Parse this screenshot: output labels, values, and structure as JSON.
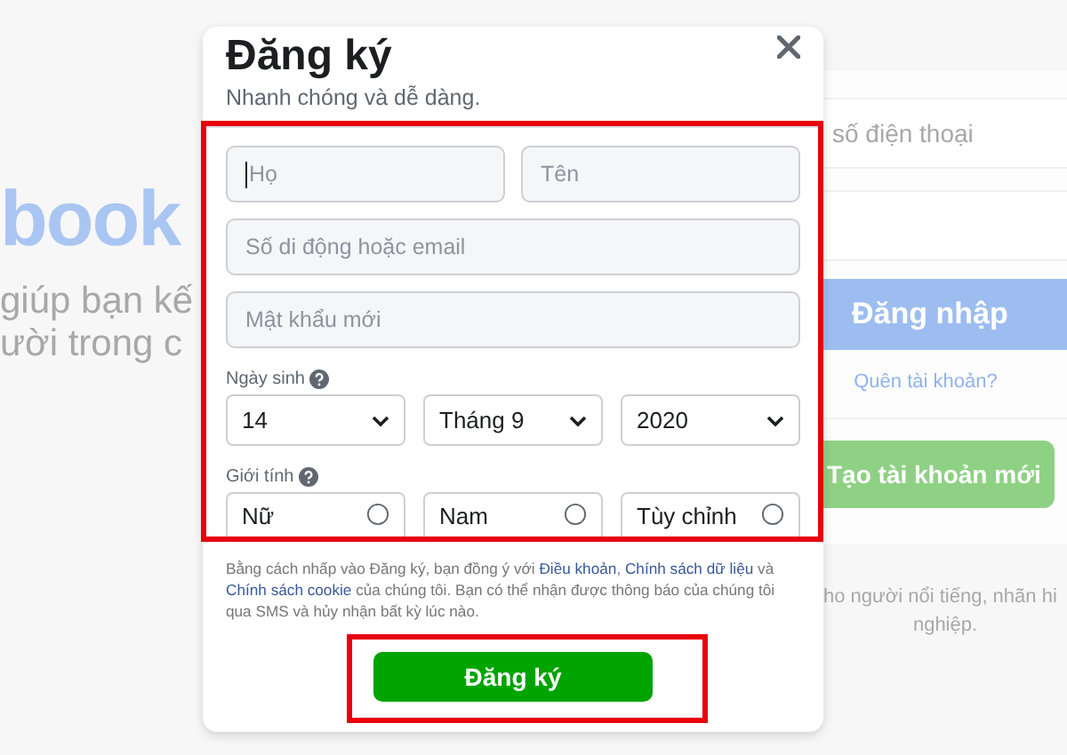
{
  "background": {
    "logo_text": "book",
    "tagline_lines": [
      "giúp bạn kế",
      "ười trong c"
    ],
    "login": {
      "phone_placeholder": "số điện thoại",
      "login_button": "Đăng nhập",
      "forgot_link": "Quên tài khoản?",
      "create_button": "Tạo tài khoản mới",
      "footer_lines": [
        "ho người nổi tiếng, nhãn hi",
        "nghiệp."
      ]
    }
  },
  "dialog": {
    "title": "Đăng ký",
    "subtitle": "Nhanh chóng và dễ dàng.",
    "name_fields": [
      {
        "placeholder": "Họ",
        "focused": true
      },
      {
        "placeholder": "Tên",
        "focused": false
      }
    ],
    "email": {
      "placeholder": "Số di động hoặc email"
    },
    "password": {
      "placeholder": "Mật khẩu mới"
    },
    "birthday": {
      "label": "Ngày sinh",
      "selects": [
        "14",
        "Tháng 9",
        "2020"
      ]
    },
    "gender": {
      "label": "Giới tính",
      "options": [
        {
          "label": "Nữ",
          "selected": false
        },
        {
          "label": "Nam",
          "selected": false
        },
        {
          "label": "Tùy chỉnh",
          "selected": false
        }
      ]
    },
    "terms": [
      {
        "kind": "text",
        "text": "Bằng cách nhấp vào Đăng ký, bạn đồng ý với "
      },
      {
        "kind": "link",
        "text": "Điều khoản"
      },
      {
        "kind": "text",
        "text": ", "
      },
      {
        "kind": "link",
        "text": "Chính sách dữ liệu"
      },
      {
        "kind": "text",
        "text": " và "
      },
      {
        "kind": "link",
        "text": "Chính sách cookie"
      },
      {
        "kind": "text",
        "text": " của chúng tôi. Bạn có thể nhận được thông báo của chúng tôi qua SMS và hủy nhận bất kỳ lúc nào."
      }
    ],
    "submit_button": "Đăng ký",
    "form_highlighted": true,
    "submit_highlighted": true
  }
}
